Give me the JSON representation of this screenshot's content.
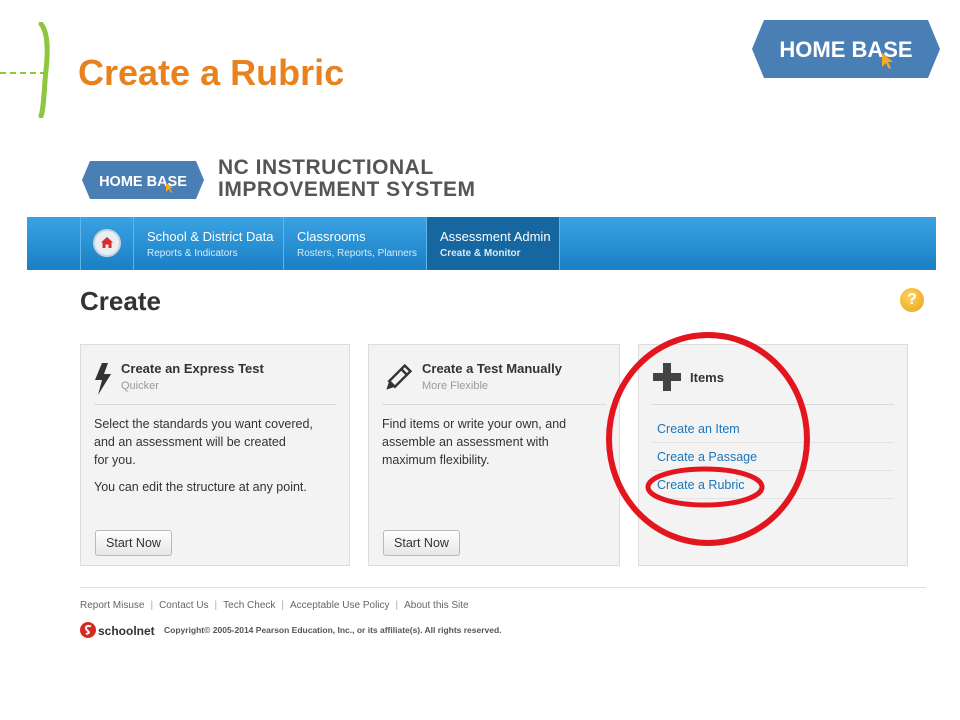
{
  "slide": {
    "title": "Create a Rubric",
    "logo_text": "HOME BASE",
    "accent_color": "#e8821e",
    "bracket_color": "#8dc63f"
  },
  "app": {
    "logo_text": "HOME BASE",
    "system_title_line1": "NC INSTRUCTIONAL",
    "system_title_line2": "IMPROVEMENT SYSTEM"
  },
  "nav": {
    "home_icon": "home-icon",
    "items": [
      {
        "title": "School & District Data",
        "subtitle": "Reports & Indicators"
      },
      {
        "title": "Classrooms",
        "subtitle": "Rosters, Reports, Planners"
      },
      {
        "title": "Assessment Admin",
        "subtitle": "Create & Monitor",
        "active": true
      }
    ]
  },
  "page": {
    "title": "Create",
    "help_label": "?"
  },
  "cards": {
    "express": {
      "icon": "lightning-icon",
      "title": "Create an Express Test",
      "subtitle": "Quicker",
      "body_line1": "Select the standards you want covered,",
      "body_line2": "and an assessment will be created",
      "body_line3": "for you.",
      "body_line4": "You can edit the structure at any point.",
      "button": "Start Now"
    },
    "manual": {
      "icon": "pencil-icon",
      "title": "Create a Test Manually",
      "subtitle": "More Flexible",
      "body_line1": "Find items or write your own, and",
      "body_line2": "assemble an assessment with",
      "body_line3": "maximum flexibility.",
      "button": "Start Now"
    },
    "items": {
      "icon": "plus-icon",
      "title": "Items",
      "links": [
        "Create an Item",
        "Create a Passage",
        "Create a Rubric"
      ]
    }
  },
  "footer": {
    "links": [
      "Report Misuse",
      "Contact Us",
      "Tech Check",
      "Acceptable Use Policy",
      "About this Site"
    ],
    "brand": "schoolnet",
    "copyright": "Copyright© 2005-2014 Pearson Education, Inc., or its affiliate(s). All rights reserved."
  },
  "annotation_color": "#e3161f"
}
